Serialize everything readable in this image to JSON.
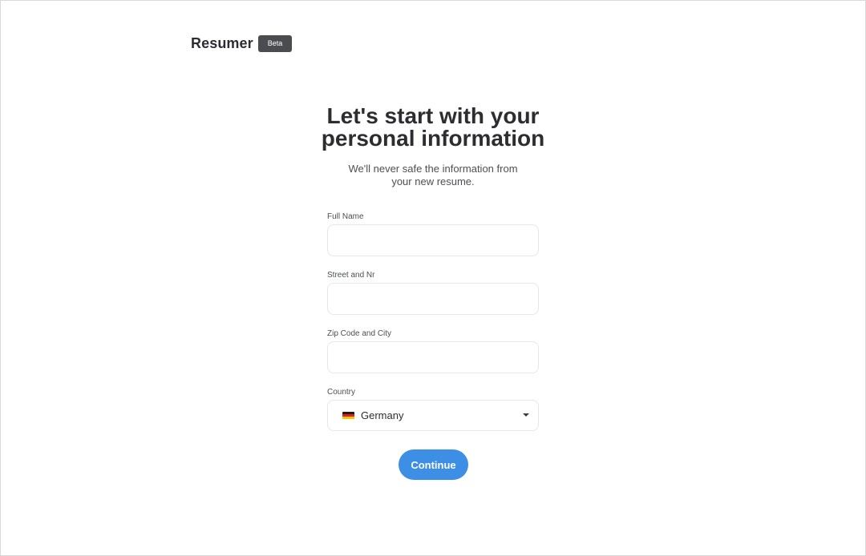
{
  "brand": {
    "name": "Resumer",
    "badge": "Beta"
  },
  "heading": {
    "line1": "Let's start with your",
    "line2": "personal information"
  },
  "subtitle": "We'll never safe the information from your new resume.",
  "form": {
    "full_name": {
      "label": "Full Name",
      "value": "",
      "placeholder": ""
    },
    "street": {
      "label": "Street and Nr",
      "value": "",
      "placeholder": ""
    },
    "zip_city": {
      "label": "Zip Code and City",
      "value": "",
      "placeholder": ""
    },
    "country": {
      "label": "Country",
      "selected": "Germany",
      "flag_icon": "germany-flag-icon",
      "flag_colors": [
        "#1a1a1a",
        "#dd1f26",
        "#f5c400"
      ]
    }
  },
  "continue_label": "Continue",
  "colors": {
    "accent": "#3d8fe6",
    "badge_bg": "#4a4c50",
    "text": "#2b2d31"
  }
}
